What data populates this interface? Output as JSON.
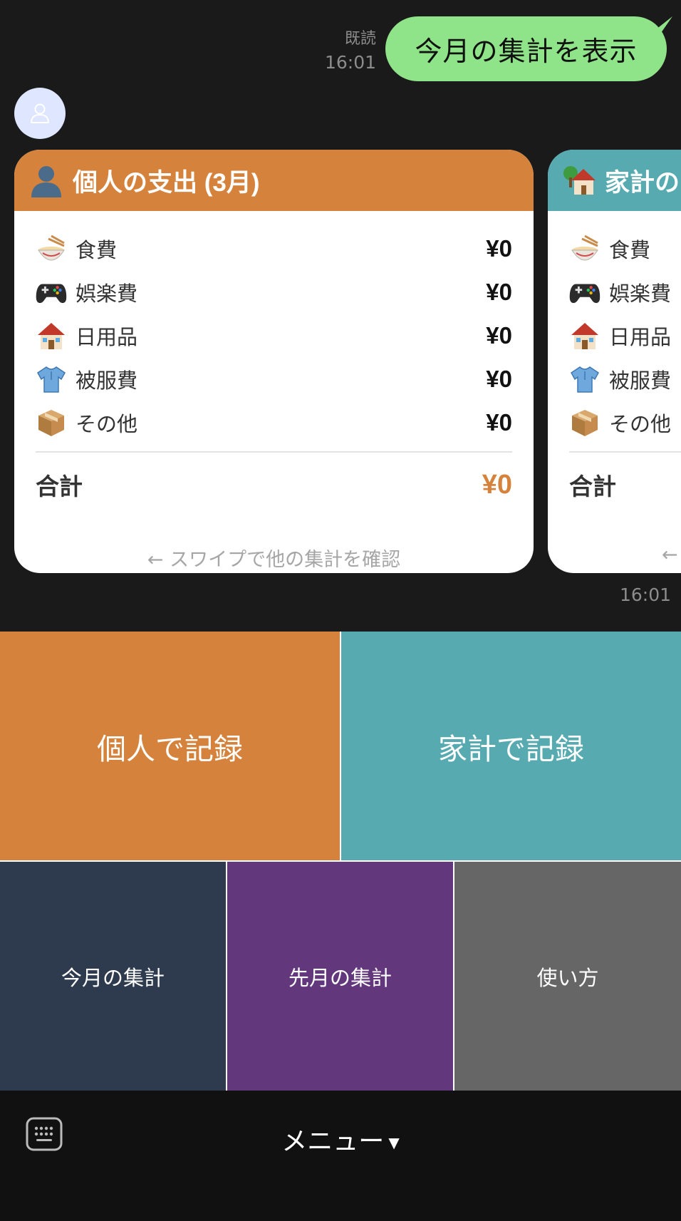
{
  "chat": {
    "outgoing": {
      "text": "今月の集計を表示",
      "read_status": "既読",
      "time": "16:01"
    },
    "incoming_time": "16:01",
    "cards": [
      {
        "header_icon": "person-silhouette-icon",
        "title": "個人の支出 (3月)",
        "accent": "#d5833c",
        "items": [
          {
            "icon": "noodle-bowl-icon",
            "label": "食費",
            "amount": "¥0"
          },
          {
            "icon": "game-controller-icon",
            "label": "娯楽費",
            "amount": "¥0"
          },
          {
            "icon": "house-icon",
            "label": "日用品",
            "amount": "¥0"
          },
          {
            "icon": "shirt-icon",
            "label": "被服費",
            "amount": "¥0"
          },
          {
            "icon": "package-icon",
            "label": "その他",
            "amount": "¥0"
          }
        ],
        "total_label": "合計",
        "total_value": "¥0",
        "swipe_hint": "← スワイプで他の集計を確認"
      },
      {
        "header_icon": "house-garden-icon",
        "title": "家計の",
        "accent": "#56aab0",
        "items": [
          {
            "icon": "noodle-bowl-icon",
            "label": "食費"
          },
          {
            "icon": "game-controller-icon",
            "label": "娯楽費"
          },
          {
            "icon": "house-icon",
            "label": "日用品"
          },
          {
            "icon": "shirt-icon",
            "label": "被服費"
          },
          {
            "icon": "package-icon",
            "label": "その他"
          }
        ],
        "total_label": "合計",
        "swipe_hint": "←"
      }
    ]
  },
  "rich_menu": {
    "personal_record": "個人で記録",
    "household_record": "家計で記録",
    "this_month": "今月の集計",
    "last_month": "先月の集計",
    "how_to": "使い方"
  },
  "bottom_bar": {
    "menu_label": "メニュー",
    "menu_arrow": "▼"
  },
  "colors": {
    "personal": "#d5833c",
    "household": "#56aab0",
    "this_month": "#2e3b4e",
    "last_month": "#62377c",
    "how_to": "#666666",
    "outgoing_bubble": "#8fe388"
  }
}
